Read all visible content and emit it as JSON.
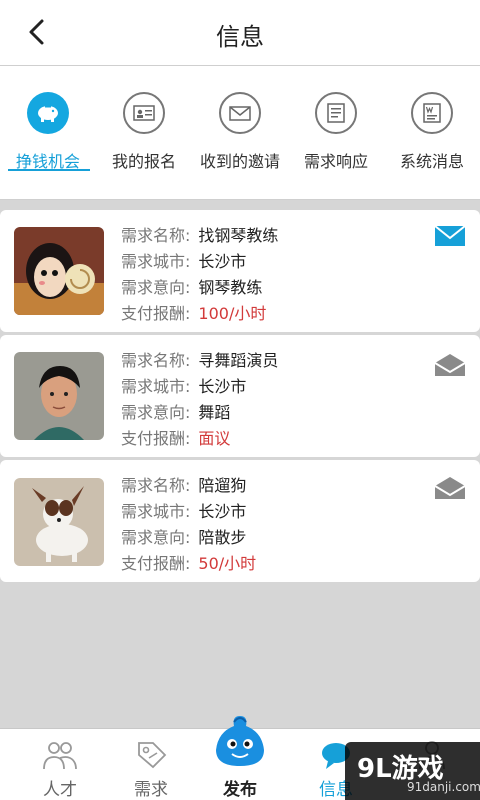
{
  "header": {
    "title": "信息"
  },
  "tabs": [
    {
      "label": "挣钱机会",
      "icon": "piggy-bank-icon"
    },
    {
      "label": "我的报名",
      "icon": "id-card-icon"
    },
    {
      "label": "收到的邀请",
      "icon": "envelope-icon"
    },
    {
      "label": "需求响应",
      "icon": "document-icon"
    },
    {
      "label": "系统消息",
      "icon": "word-document-icon"
    }
  ],
  "field_labels": {
    "name": "需求名称:",
    "city": "需求城市:",
    "intent": "需求意向:",
    "pay": "支付报酬:"
  },
  "cards": [
    {
      "name": "找钢琴教练",
      "city": "长沙市",
      "intent": "钢琴教练",
      "pay": "100/小时",
      "mail_state": "unread",
      "avatar": "cartoon-girl-with-snail-image"
    },
    {
      "name": "寻舞蹈演员",
      "city": "长沙市",
      "intent": "舞蹈",
      "pay": "面议",
      "mail_state": "read",
      "avatar": "young-man-portrait-image"
    },
    {
      "name": "陪遛狗",
      "city": "长沙市",
      "intent": "陪散步",
      "pay": "50/小时",
      "mail_state": "read",
      "avatar": "puppy-image"
    }
  ],
  "bottom_nav": [
    {
      "label": "人才",
      "icon": "people-icon"
    },
    {
      "label": "需求",
      "icon": "tag-icon"
    },
    {
      "label": "发布",
      "icon": "blue-mascot-icon"
    },
    {
      "label": "信息",
      "icon": "chat-bubble-icon"
    },
    {
      "label": "",
      "icon": "user-icon"
    }
  ],
  "watermark": {
    "line1": "9L游戏",
    "line2": "91danji.com"
  },
  "colors": {
    "accent": "#16a0d8",
    "pay_text": "#d23a3a",
    "background": "#d6d6d6"
  }
}
